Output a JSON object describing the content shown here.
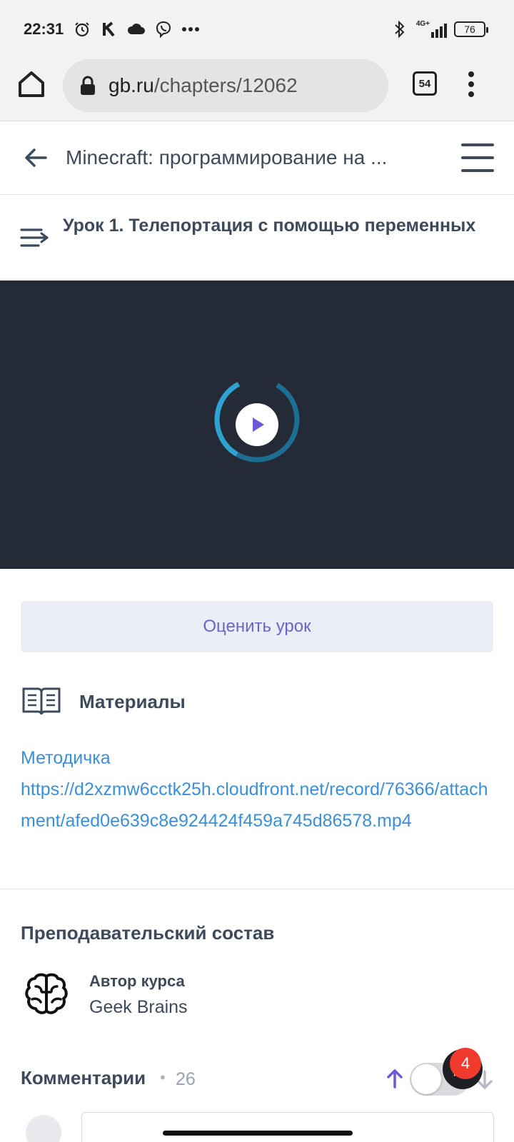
{
  "status_bar": {
    "time": "22:31",
    "network": "4G+",
    "battery": "76",
    "left_icons": [
      "alarm-icon",
      "k-app-icon",
      "cloud-icon",
      "viber-icon",
      "more-icon"
    ]
  },
  "browser": {
    "url_host": "gb.ru",
    "url_path": "/chapters/12062",
    "tab_count": "54"
  },
  "header": {
    "course_title": "Minecraft: программирование на ..."
  },
  "lesson": {
    "title": "Урок 1. Телепортация с помощью переменных"
  },
  "rate": {
    "label": "Оценить урок"
  },
  "materials": {
    "title": "Материалы",
    "links": [
      {
        "label": "Методичка"
      },
      {
        "label": "https://d2xzmw6cctk25h.cloudfront.net/record/76366/attachment/afed0e639c8e924424f459a745d86578.mp4"
      }
    ]
  },
  "teachers": {
    "title": "Преподавательский состав",
    "author_role": "Автор курса",
    "author_name": "Geek Brains"
  },
  "comments": {
    "title": "Комментарии",
    "separator": "•",
    "count": "26",
    "notification_count": "4"
  },
  "colors": {
    "accent": "#6c63c7",
    "link": "#3b8fd9",
    "video_bg": "#242b36",
    "badge": "#f03a2e"
  }
}
